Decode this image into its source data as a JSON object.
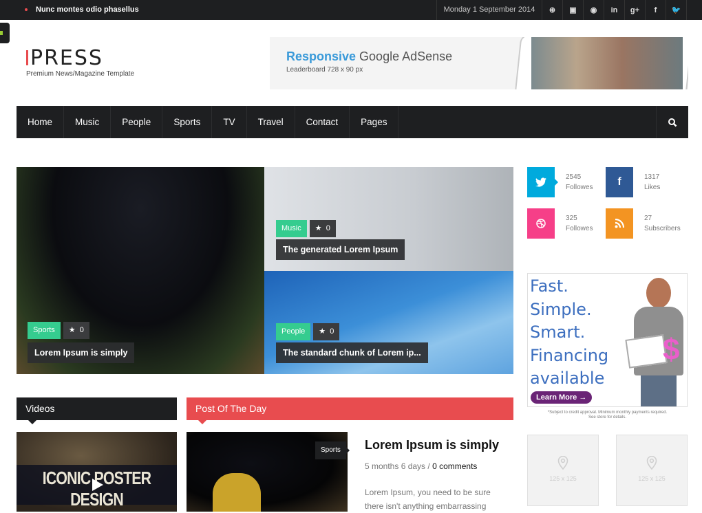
{
  "topbar": {
    "ticker": "Nunc montes odio phasellus",
    "date": "Monday 1 September 2014",
    "social_icons": [
      {
        "name": "dribbble-icon",
        "glyph": "⊛"
      },
      {
        "name": "instagram-icon",
        "glyph": "▣"
      },
      {
        "name": "github-icon",
        "glyph": "◉"
      },
      {
        "name": "linkedin-icon",
        "glyph": "in"
      },
      {
        "name": "google-plus-icon",
        "glyph": "g+"
      },
      {
        "name": "facebook-icon",
        "glyph": "f"
      },
      {
        "name": "twitter-icon",
        "glyph": "🐦"
      }
    ]
  },
  "logo": {
    "brand": "PRESS",
    "tagline": "Premium News/Magazine Template"
  },
  "leaderboard_ad": {
    "highlight": "Responsive",
    "title_rest": " Google AdSense",
    "subtitle": "Leaderboard 728 x 90 px"
  },
  "nav": {
    "items": [
      "Home",
      "Music",
      "People",
      "Sports",
      "TV",
      "Travel",
      "Contact",
      "Pages"
    ],
    "search_glyph": "⚲"
  },
  "featured": [
    {
      "category": "Sports",
      "stars": "0",
      "title": "Lorem Ipsum is simply"
    },
    {
      "category": "Music",
      "stars": "0",
      "title": "The generated Lorem Ipsum"
    },
    {
      "category": "People",
      "stars": "0",
      "title": "The standard chunk of Lorem ip..."
    }
  ],
  "star_glyph": "★",
  "social_counters": [
    {
      "network": "twitter",
      "glyph": "🐦",
      "count": "2545",
      "label": "Followes",
      "color": "#00aadd"
    },
    {
      "network": "facebook",
      "glyph": "f",
      "count": "1317",
      "label": "Likes",
      "color": "#2f5995"
    },
    {
      "network": "dribbble",
      "glyph": "⊛",
      "count": "325",
      "label": "Followes",
      "color": "#f63f88"
    },
    {
      "network": "rss",
      "glyph": "◔",
      "count": "27",
      "label": "Subscribers",
      "color": "#f39422"
    }
  ],
  "sidebar_ad": {
    "lines": [
      "Fast.",
      "Simple.",
      "Smart.",
      "Financing",
      "available"
    ],
    "button": "Learn More →",
    "dollar": "$",
    "fine_print_1": "*Subject to credit approval. Minimum monthly payments required.",
    "fine_print_2": "See store for details."
  },
  "placeholders": [
    {
      "label": "125 x 125"
    },
    {
      "label": "125 x 125"
    }
  ],
  "videos": {
    "heading": "Videos",
    "heading_color": "#1e1f21",
    "video_title": "ICONIC POSTER DESIGN"
  },
  "post_of_day": {
    "heading": "Post Of The Day",
    "heading_color": "#e84c4f",
    "category": "Sports",
    "title": "Lorem Ipsum is simply",
    "age": "5 months 6 days / ",
    "comments": "0 comments",
    "excerpt": "Lorem Ipsum, you need to be sure there isn't anything embarrassing"
  },
  "colors": {
    "accent_red": "#e84c4f",
    "category_green": "#35cc8f",
    "dark": "#1e1f21"
  }
}
